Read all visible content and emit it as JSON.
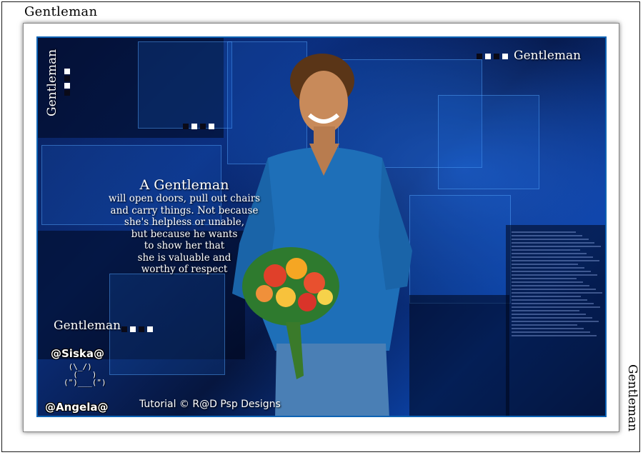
{
  "top_title": "Gentleman",
  "side_title": "Gentleman",
  "art": {
    "vertical_label": "Gentleman",
    "top_right_label": "Gentleman",
    "lower_left_label": "Gentleman",
    "quote": {
      "heading": "A Gentleman",
      "lines": [
        "will open doors, pull out chairs",
        "and carry things.  Not because",
        "she's helpless or unable,",
        "but because he wants",
        "to show her that",
        "she is valuable and",
        "worthy of respect"
      ]
    },
    "footer": "Tutorial © R@D Psp Designs",
    "signature_top": "@Siska@",
    "signature_bottom": "@Angela@",
    "colors": {
      "accent_blue": "#0d63b5",
      "deep_blue": "#0a1f5c"
    }
  }
}
